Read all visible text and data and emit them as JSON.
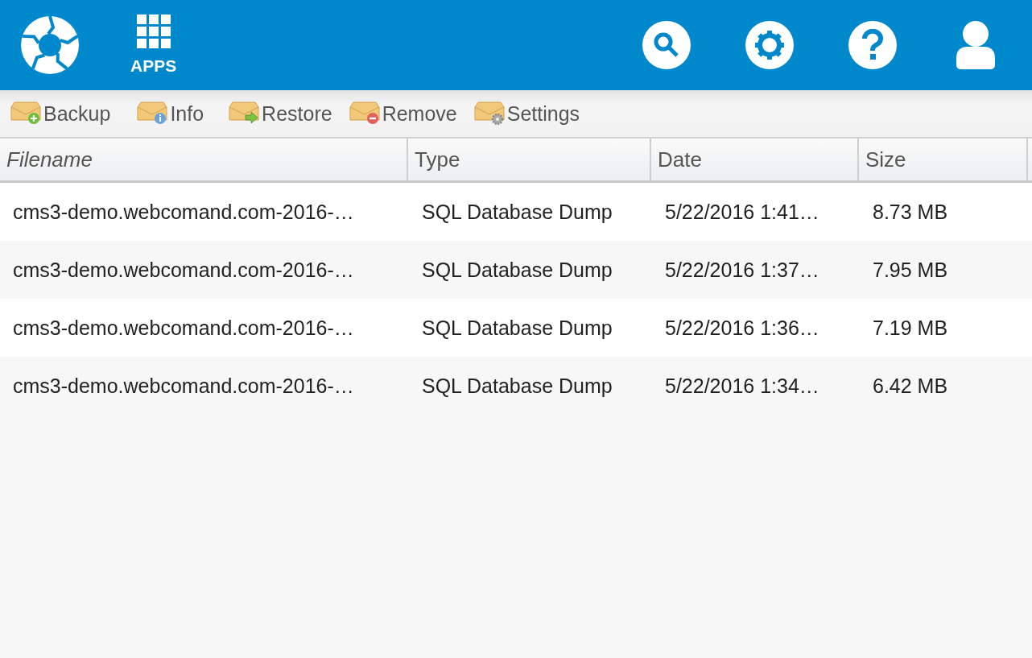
{
  "header": {
    "apps_label": "APPS"
  },
  "toolbar": [
    {
      "label": "Backup",
      "kind": "add"
    },
    {
      "label": "Info",
      "kind": "info"
    },
    {
      "label": "Restore",
      "kind": "restore"
    },
    {
      "label": "Remove",
      "kind": "remove"
    },
    {
      "label": "Settings",
      "kind": "settings"
    }
  ],
  "table": {
    "columns": [
      {
        "label": "Filename",
        "sorted": true
      },
      {
        "label": "Type",
        "sorted": false
      },
      {
        "label": "Date",
        "sorted": false
      },
      {
        "label": "Size",
        "sorted": false
      }
    ],
    "rows": [
      [
        "cms3-demo.webcomand.com-2016-…",
        "SQL Database Dump",
        "5/22/2016 1:41…",
        "8.73 MB"
      ],
      [
        "cms3-demo.webcomand.com-2016-…",
        "SQL Database Dump",
        "5/22/2016 1:37…",
        "7.95 MB"
      ],
      [
        "cms3-demo.webcomand.com-2016-…",
        "SQL Database Dump",
        "5/22/2016 1:36…",
        "7.19 MB"
      ],
      [
        "cms3-demo.webcomand.com-2016-…",
        "SQL Database Dump",
        "5/22/2016 1:34…",
        "6.42 MB"
      ]
    ]
  }
}
